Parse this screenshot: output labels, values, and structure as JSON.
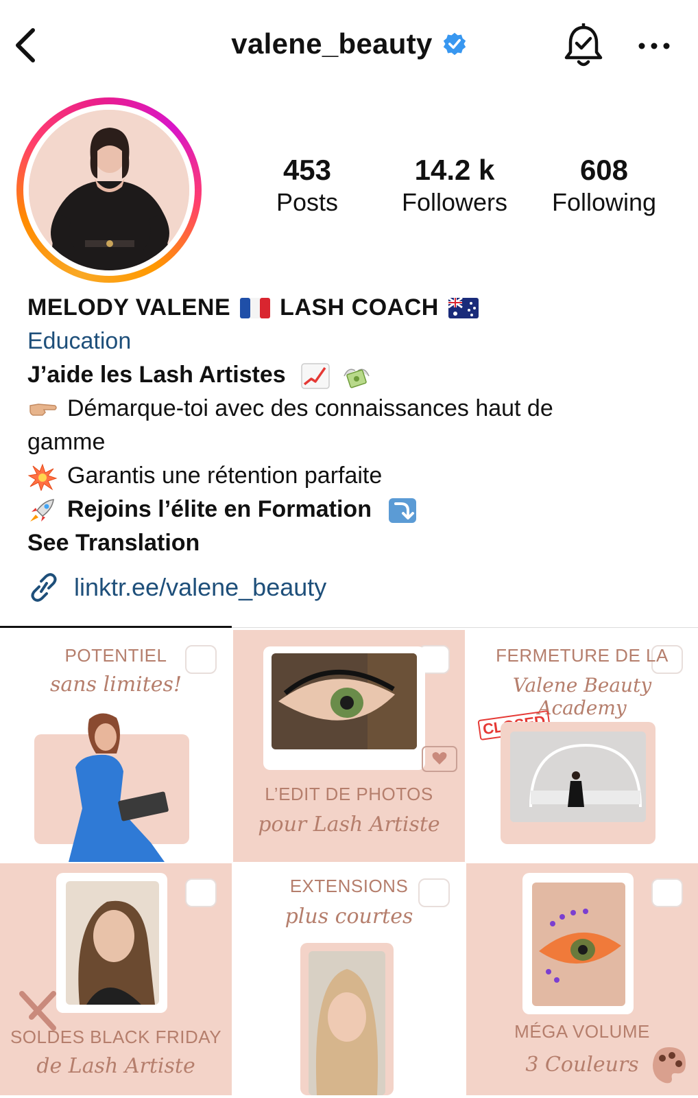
{
  "header": {
    "username": "valene_beauty",
    "verified": true,
    "icons": [
      "back-arrow-icon",
      "verified-badge-icon",
      "notification-bell-icon",
      "more-options-icon"
    ]
  },
  "stats": {
    "posts": {
      "value": "453",
      "label": "Posts"
    },
    "followers": {
      "value": "14.2 k",
      "label": "Followers"
    },
    "following": {
      "value": "608",
      "label": "Following"
    }
  },
  "bio": {
    "name_part1": "MELODY VALENE",
    "name_part2": "LASH COACH",
    "category": "Education",
    "line1": "J’aide les Lash Artistes",
    "line2a": "Démarque-toi avec des connaissances haut de",
    "line2b": "gamme",
    "line3": "Garantis une rétention parfaite",
    "line4": "Rejoins l’élite en Formation",
    "see_translation": "See Translation",
    "link": "linktr.ee/valene_beauty"
  },
  "grid": {
    "t1": {
      "caps": "POTENTIEL",
      "script": "sans limites!"
    },
    "t2": {
      "caps": "L’EDIT DE PHOTOS",
      "script": "pour Lash Artiste"
    },
    "t3": {
      "caps": "FERMETURE DE LA",
      "script": "Valene Beauty Academy",
      "badge": "CLOSED"
    },
    "t4": {
      "caps": "SOLDES BLACK FRIDAY",
      "script": "de Lash Artiste"
    },
    "t5": {
      "caps": "EXTENSIONS",
      "script": "plus courtes"
    },
    "t6": {
      "caps": "MÉGA VOLUME",
      "script": "3 Couleurs"
    }
  },
  "colors": {
    "accent_link": "#1e4f7a",
    "verified_blue": "#3897f0",
    "tile_pink": "#f3d3c8",
    "tile_text": "#b57e6c"
  }
}
